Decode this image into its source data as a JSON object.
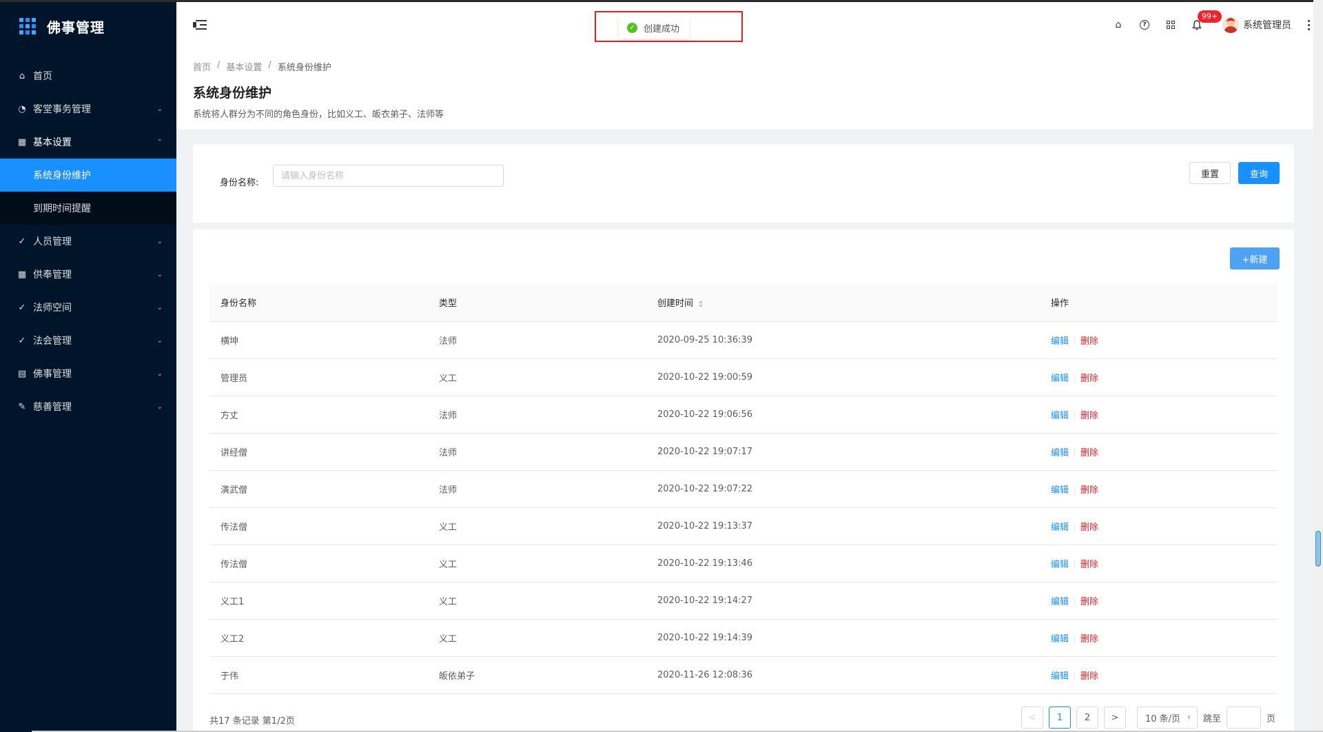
{
  "app": {
    "title": "佛事管理"
  },
  "sidebar": {
    "items": [
      {
        "label": "首页",
        "icon": "home-icon",
        "glyph": "⌂",
        "arrow": ""
      },
      {
        "label": "客堂事务管理",
        "icon": "dashboard-icon",
        "glyph": "◔",
        "arrow": "⌄"
      },
      {
        "label": "基本设置",
        "icon": "table-icon",
        "glyph": "▦",
        "arrow": "⌃"
      },
      {
        "label": "人员管理",
        "icon": "check-circle-icon",
        "glyph": "✓",
        "arrow": "⌄"
      },
      {
        "label": "供奉管理",
        "icon": "table-icon",
        "glyph": "▦",
        "arrow": "⌄"
      },
      {
        "label": "法师空间",
        "icon": "check-circle-icon",
        "glyph": "✓",
        "arrow": "⌄"
      },
      {
        "label": "法会管理",
        "icon": "check-circle-icon",
        "glyph": "✓",
        "arrow": "⌄"
      },
      {
        "label": "佛事管理",
        "icon": "profile-icon",
        "glyph": "▤",
        "arrow": "⌄"
      },
      {
        "label": "慈善管理",
        "icon": "form-icon",
        "glyph": "✎",
        "arrow": "⌄"
      }
    ],
    "submenu": [
      {
        "label": "系统身份维护"
      },
      {
        "label": "到期时间提醒"
      }
    ]
  },
  "toast": {
    "message": "创建成功",
    "status_color": "#52c41a"
  },
  "header": {
    "badge": "99+",
    "user_name": "系统管理员"
  },
  "breadcrumb": [
    "首页",
    "基本设置",
    "系统身份维护"
  ],
  "page": {
    "title": "系统身份维护",
    "description": "系统将人群分为不同的角色身份，比如义工、皈衣弟子、法师等"
  },
  "search": {
    "label": "身份名称:",
    "placeholder": "请输入身份名称",
    "value": "",
    "reset_label": "重置",
    "query_label": "查询"
  },
  "table": {
    "new_label": "+新建",
    "columns": [
      "身份名称",
      "类型",
      "创建时间",
      "操作"
    ],
    "edit_label": "编辑",
    "delete_label": "删除",
    "rows": [
      {
        "name": "横坤",
        "type": "法师",
        "created": "2020-09-25 10:36:39"
      },
      {
        "name": "管理员",
        "type": "义工",
        "created": "2020-10-22 19:00:59"
      },
      {
        "name": "方丈",
        "type": "法师",
        "created": "2020-10-22 19:06:56"
      },
      {
        "name": "讲经僧",
        "type": "法师",
        "created": "2020-10-22 19:07:17"
      },
      {
        "name": "演武僧",
        "type": "法师",
        "created": "2020-10-22 19:07:22"
      },
      {
        "name": "传法僧",
        "type": "义工",
        "created": "2020-10-22 19:13:37"
      },
      {
        "name": "传法僧",
        "type": "义工",
        "created": "2020-10-22 19:13:46"
      },
      {
        "name": "义工1",
        "type": "义工",
        "created": "2020-10-22 19:14:27"
      },
      {
        "name": "义工2",
        "type": "义工",
        "created": "2020-10-22 19:14:39"
      },
      {
        "name": "于伟",
        "type": "皈依弟子",
        "created": "2020-11-26 12:08:36"
      }
    ]
  },
  "pagination": {
    "total_text": "共17 条记录 第1/2页",
    "pages": [
      "1",
      "2"
    ],
    "current": "1",
    "page_size": "10 条/页",
    "jump_label": "跳至",
    "jump_unit": "页"
  },
  "colors": {
    "primary": "#1890ff",
    "sidebar_bg": "#001529",
    "danger": "#f5222d"
  }
}
